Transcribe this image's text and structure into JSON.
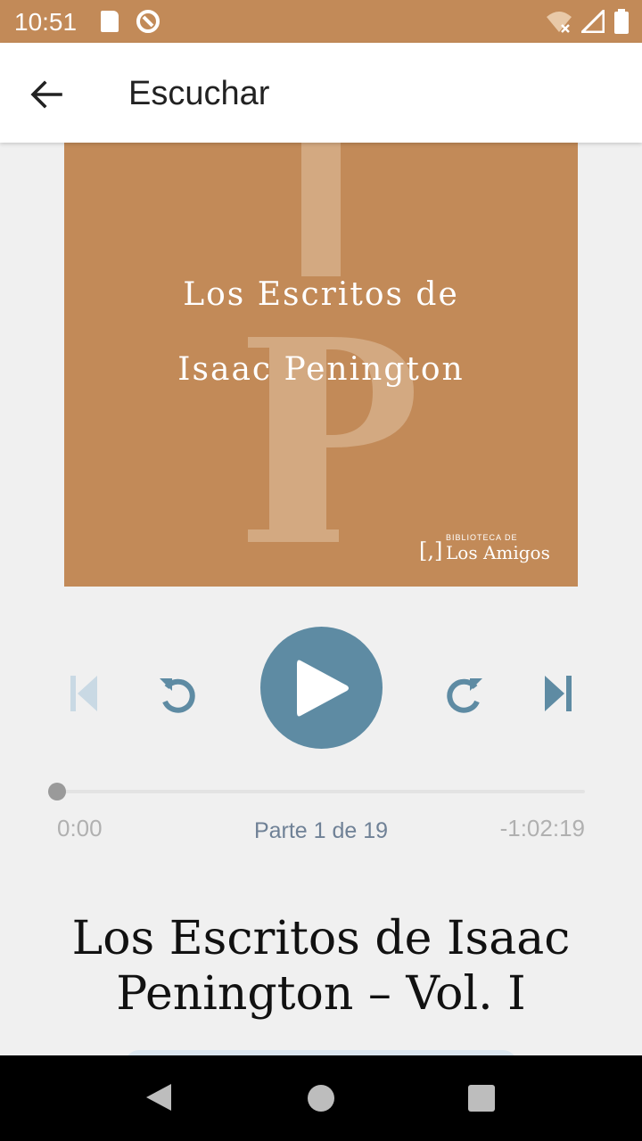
{
  "status_bar": {
    "time": "10:51",
    "icons": [
      "sd-card-icon",
      "app-notification-icon",
      "wifi-icon",
      "signal-icon",
      "battery-icon"
    ]
  },
  "app_bar": {
    "title": "Escuchar",
    "back_icon": "arrow-left-icon"
  },
  "cover": {
    "title_line1": "Los Escritos de",
    "title_line2": "Isaac Penington",
    "monogram": "IP",
    "publisher_small": "BIBLIOTECA DE",
    "publisher_main": "Los Amigos",
    "background_color": "#c28a58"
  },
  "player": {
    "controls": {
      "previous_icon": "skip-previous-icon",
      "rewind_icon": "replay-icon",
      "play_icon": "play-icon",
      "forward_icon": "forward-icon",
      "next_icon": "skip-next-icon",
      "previous_enabled": false
    },
    "elapsed": "0:00",
    "remaining": "-1:02:19",
    "part_label": "Parte 1 de 19",
    "progress_fraction": 0,
    "accent_color": "#5e8ba3"
  },
  "book": {
    "title": "Los Escritos de Isaac Penington – Vol. I"
  },
  "nav_bar": {
    "icons": [
      "nav-back-icon",
      "nav-home-icon",
      "nav-recents-icon"
    ]
  }
}
